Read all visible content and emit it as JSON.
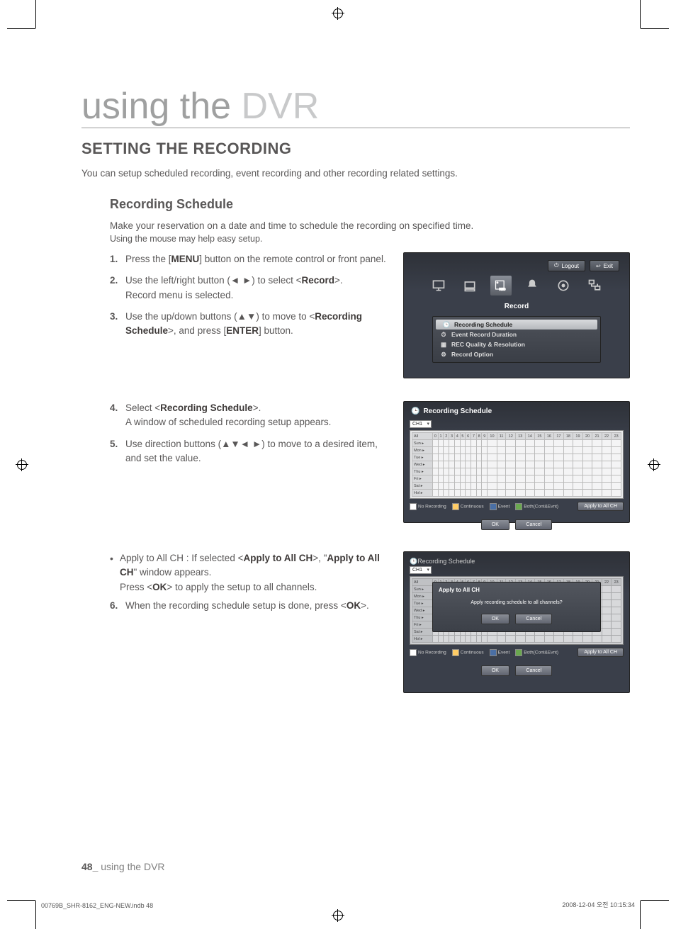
{
  "page_title_dark": "using the ",
  "page_title_light": "DVR",
  "section_heading": "SETTING THE RECORDING",
  "intro": "You can setup scheduled recording, event recording and other recording related settings.",
  "sub_heading": "Recording Schedule",
  "desc": "Make your reservation on a date and time to schedule the recording on specified time.",
  "small": "Using the mouse may help easy setup.",
  "steps_a": [
    {
      "n": "1.",
      "pre": "Press the [",
      "b1": "MENU",
      "post": "] button on the remote control or front panel."
    },
    {
      "n": "2.",
      "pre": "Use the left/right button (◄ ►) to select <",
      "b1": "Record",
      "post": ">.",
      "tail": "Record menu is selected."
    },
    {
      "n": "3.",
      "pre": "Use the up/down buttons (▲▼) to move to <",
      "b1": "Recording Schedule",
      "post": ">, and press [",
      "b2": "ENTER",
      "post2": "] button."
    }
  ],
  "steps_b": [
    {
      "n": "4.",
      "pre": "Select <",
      "b1": "Recording Schedule",
      "post": ">.",
      "tail": "A window of scheduled recording setup appears."
    },
    {
      "n": "5.",
      "pre": "Use direction buttons (▲▼◄ ►) to move to a desired item, and set the value."
    }
  ],
  "note": {
    "pre": "Apply to All CH : If selected <",
    "b1": "Apply to All CH",
    "mid": ">, \"",
    "b2": "Apply to All CH",
    "post": "\" window appears.",
    "tail_pre": "Press <",
    "tail_b": "OK",
    "tail_post": "> to apply the setup to all channels."
  },
  "step6": {
    "n": "6.",
    "pre": "When the recording schedule setup is done, press <",
    "b1": "OK",
    "post": ">."
  },
  "shot1": {
    "logout": "Logout",
    "exit": "Exit",
    "title": "Record",
    "items": [
      "Recording Schedule",
      "Event Record Duration",
      "REC Quality & Resolution",
      "Record Option"
    ]
  },
  "shot2": {
    "title": "Recording Schedule",
    "ch": "CH1",
    "rows": [
      "All",
      "Sun",
      "Mon",
      "Tue",
      "Wed",
      "Thu",
      "Fri",
      "Sat",
      "Hol"
    ],
    "legend": {
      "nr": "No Recording",
      "cont": "Continuous",
      "ev": "Event",
      "both": "Both(Cont&Evnt)"
    },
    "apply": "Apply to All CH",
    "ok": "OK",
    "cancel": "Cancel"
  },
  "shot3": {
    "title": "Recording Schedule",
    "ch": "CH1",
    "modal_title": "Apply to All CH",
    "modal_msg": "Apply recording schedule to all channels?",
    "ok": "OK",
    "cancel": "Cancel",
    "rows": [
      "All",
      "Sun",
      "Mon",
      "Tue",
      "Wed",
      "Thu",
      "Fri",
      "Sat",
      "Hol"
    ],
    "legend": {
      "nr": "No Recording",
      "cont": "Continuous",
      "ev": "Event",
      "both": "Both(Cont&Evnt)"
    },
    "apply": "Apply to All CH"
  },
  "footer": {
    "page": "48_",
    "label": "using the DVR"
  },
  "bleed": {
    "file": "00769B_SHR-8162_ENG-NEW.indb   48",
    "ts": "2008-12-04   오전 10:15:34"
  }
}
